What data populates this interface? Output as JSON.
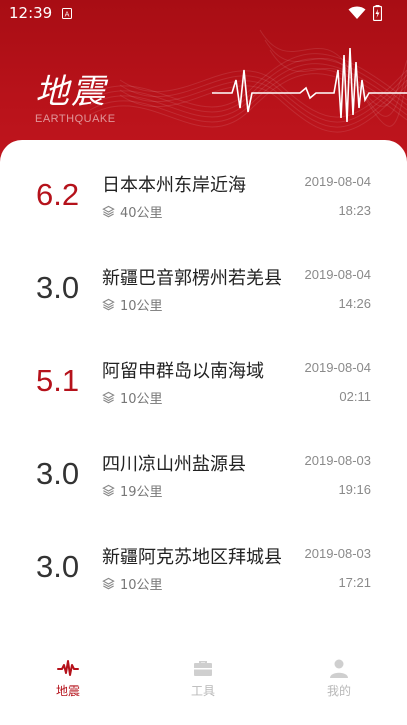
{
  "status_bar": {
    "time": "12:39"
  },
  "header": {
    "title": "地震",
    "subtitle": "EARTHQUAKE"
  },
  "colors": {
    "accent": "#b5121b",
    "neutral_mag": "#333333",
    "muted": "#8a8a8a"
  },
  "earthquakes": [
    {
      "magnitude": "6.2",
      "highlight": true,
      "place": "日本本州东岸近海",
      "depth": "40公里",
      "date": "2019-08-04",
      "time": "18:23"
    },
    {
      "magnitude": "3.0",
      "highlight": false,
      "place": "新疆巴音郭楞州若羌县",
      "depth": "10公里",
      "date": "2019-08-04",
      "time": "14:26"
    },
    {
      "magnitude": "5.1",
      "highlight": true,
      "place": "阿留申群岛以南海域",
      "depth": "10公里",
      "date": "2019-08-04",
      "time": "02:11"
    },
    {
      "magnitude": "3.0",
      "highlight": false,
      "place": "四川凉山州盐源县",
      "depth": "19公里",
      "date": "2019-08-03",
      "time": "19:16"
    },
    {
      "magnitude": "3.0",
      "highlight": false,
      "place": "新疆阿克苏地区拜城县",
      "depth": "10公里",
      "date": "2019-08-03",
      "time": "17:21"
    }
  ],
  "tabs": [
    {
      "label": "地震",
      "icon": "earthquake-wave-icon",
      "active": true
    },
    {
      "label": "工具",
      "icon": "toolbox-icon",
      "active": false
    },
    {
      "label": "我的",
      "icon": "person-icon",
      "active": false
    }
  ]
}
